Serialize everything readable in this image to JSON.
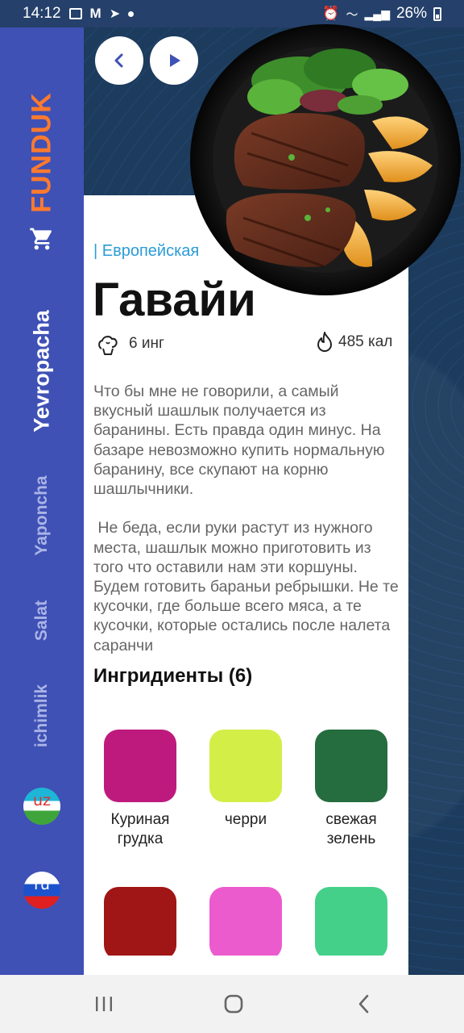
{
  "status": {
    "time": "14:12",
    "battery": "26%"
  },
  "sidebar": {
    "logo": "FUNDUK",
    "categories": [
      {
        "label": "Yevropacha"
      },
      {
        "label": "Yaponcha"
      },
      {
        "label": "Salat"
      },
      {
        "label": "ichimlik"
      }
    ],
    "languages": [
      {
        "code": "uz"
      },
      {
        "code": "ru"
      }
    ]
  },
  "recipe": {
    "cuisine": "| Европейская",
    "title": "Гавайи",
    "ingredients_count": "6 инг",
    "calories": "485 кал",
    "description": "Что бы мне не говорили, а самый вкусный шашлык получается из баранины. Есть правда один минус. На базаре невозможно купить нормальную баранину, все скупают на корню шашлычники.\n\n Не беда, если руки растут из нужного места, шашлык можно приготовить из того что оставили нам эти коршуны. Будем готовить бараньи ребрышки. Не те кусочки, где больше всего мяса, а те кусочки, которые остались после налета саранчи",
    "ingredients_title": "Ингридиенты (6)",
    "ingredients": [
      {
        "name": "Куриная грудка",
        "color": "#be1a7e"
      },
      {
        "name": "черри",
        "color": "#d4ee48"
      },
      {
        "name": "свежая зелень",
        "color": "#256c3f"
      },
      {
        "name": "",
        "color": "#a01515"
      },
      {
        "name": "",
        "color": "#ec5bcd"
      },
      {
        "name": "",
        "color": "#45d08a"
      }
    ]
  },
  "icons": {
    "back": "chevron-left-icon",
    "play": "play-icon",
    "cart": "cart-icon",
    "chef": "chef-hat-icon",
    "fire": "flame-icon"
  },
  "colors": {
    "sidebar": "#3f51b5",
    "logo": "#ff7a2e",
    "accent": "#2b9bd6",
    "nav_icon": "#3f51b5"
  }
}
